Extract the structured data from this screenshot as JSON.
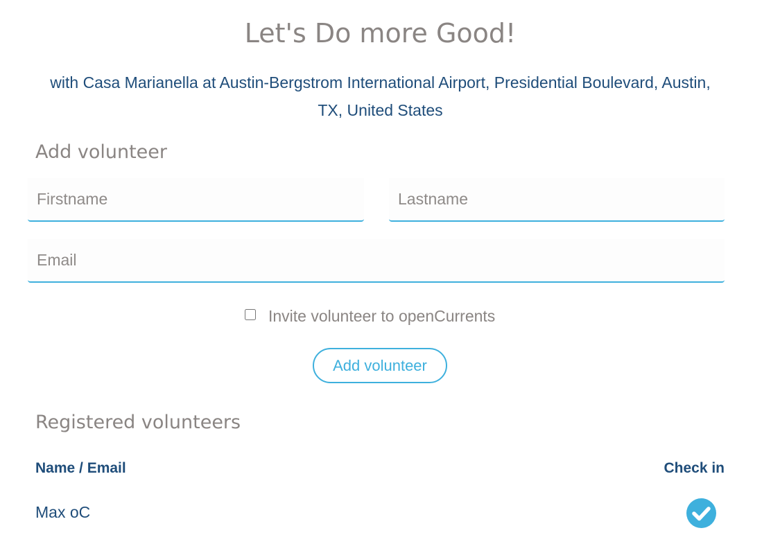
{
  "header": {
    "title": "Let's Do more Good!",
    "subtitle": "with Casa Marianella at Austin-Bergstrom International Airport, Presidential Boulevard, Austin, TX, United States"
  },
  "add_volunteer": {
    "heading": "Add volunteer",
    "firstname_placeholder": "Firstname",
    "lastname_placeholder": "Lastname",
    "email_placeholder": "Email",
    "invite_label": "Invite volunteer to openCurrents",
    "invite_checked": false,
    "button_label": "Add volunteer"
  },
  "registered": {
    "heading": "Registered volunteers",
    "columns": {
      "name": "Name / Email",
      "checkin": "Check in"
    },
    "rows": [
      {
        "name": "Max oC",
        "checked_in": true
      }
    ]
  },
  "colors": {
    "accent": "#3eb0dd",
    "navy_text": "#1f4d7a",
    "gray_text": "#8a8583"
  }
}
